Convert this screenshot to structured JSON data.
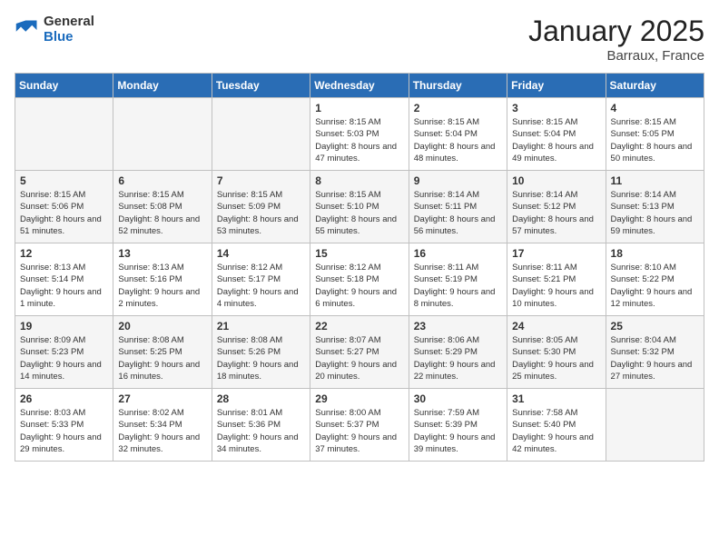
{
  "header": {
    "logo_general": "General",
    "logo_blue": "Blue",
    "title": "January 2025",
    "subtitle": "Barraux, France"
  },
  "weekdays": [
    "Sunday",
    "Monday",
    "Tuesday",
    "Wednesday",
    "Thursday",
    "Friday",
    "Saturday"
  ],
  "weeks": [
    [
      {
        "day": "",
        "info": ""
      },
      {
        "day": "",
        "info": ""
      },
      {
        "day": "",
        "info": ""
      },
      {
        "day": "1",
        "info": "Sunrise: 8:15 AM\nSunset: 5:03 PM\nDaylight: 8 hours\nand 47 minutes."
      },
      {
        "day": "2",
        "info": "Sunrise: 8:15 AM\nSunset: 5:04 PM\nDaylight: 8 hours\nand 48 minutes."
      },
      {
        "day": "3",
        "info": "Sunrise: 8:15 AM\nSunset: 5:04 PM\nDaylight: 8 hours\nand 49 minutes."
      },
      {
        "day": "4",
        "info": "Sunrise: 8:15 AM\nSunset: 5:05 PM\nDaylight: 8 hours\nand 50 minutes."
      }
    ],
    [
      {
        "day": "5",
        "info": "Sunrise: 8:15 AM\nSunset: 5:06 PM\nDaylight: 8 hours\nand 51 minutes."
      },
      {
        "day": "6",
        "info": "Sunrise: 8:15 AM\nSunset: 5:08 PM\nDaylight: 8 hours\nand 52 minutes."
      },
      {
        "day": "7",
        "info": "Sunrise: 8:15 AM\nSunset: 5:09 PM\nDaylight: 8 hours\nand 53 minutes."
      },
      {
        "day": "8",
        "info": "Sunrise: 8:15 AM\nSunset: 5:10 PM\nDaylight: 8 hours\nand 55 minutes."
      },
      {
        "day": "9",
        "info": "Sunrise: 8:14 AM\nSunset: 5:11 PM\nDaylight: 8 hours\nand 56 minutes."
      },
      {
        "day": "10",
        "info": "Sunrise: 8:14 AM\nSunset: 5:12 PM\nDaylight: 8 hours\nand 57 minutes."
      },
      {
        "day": "11",
        "info": "Sunrise: 8:14 AM\nSunset: 5:13 PM\nDaylight: 8 hours\nand 59 minutes."
      }
    ],
    [
      {
        "day": "12",
        "info": "Sunrise: 8:13 AM\nSunset: 5:14 PM\nDaylight: 9 hours\nand 1 minute."
      },
      {
        "day": "13",
        "info": "Sunrise: 8:13 AM\nSunset: 5:16 PM\nDaylight: 9 hours\nand 2 minutes."
      },
      {
        "day": "14",
        "info": "Sunrise: 8:12 AM\nSunset: 5:17 PM\nDaylight: 9 hours\nand 4 minutes."
      },
      {
        "day": "15",
        "info": "Sunrise: 8:12 AM\nSunset: 5:18 PM\nDaylight: 9 hours\nand 6 minutes."
      },
      {
        "day": "16",
        "info": "Sunrise: 8:11 AM\nSunset: 5:19 PM\nDaylight: 9 hours\nand 8 minutes."
      },
      {
        "day": "17",
        "info": "Sunrise: 8:11 AM\nSunset: 5:21 PM\nDaylight: 9 hours\nand 10 minutes."
      },
      {
        "day": "18",
        "info": "Sunrise: 8:10 AM\nSunset: 5:22 PM\nDaylight: 9 hours\nand 12 minutes."
      }
    ],
    [
      {
        "day": "19",
        "info": "Sunrise: 8:09 AM\nSunset: 5:23 PM\nDaylight: 9 hours\nand 14 minutes."
      },
      {
        "day": "20",
        "info": "Sunrise: 8:08 AM\nSunset: 5:25 PM\nDaylight: 9 hours\nand 16 minutes."
      },
      {
        "day": "21",
        "info": "Sunrise: 8:08 AM\nSunset: 5:26 PM\nDaylight: 9 hours\nand 18 minutes."
      },
      {
        "day": "22",
        "info": "Sunrise: 8:07 AM\nSunset: 5:27 PM\nDaylight: 9 hours\nand 20 minutes."
      },
      {
        "day": "23",
        "info": "Sunrise: 8:06 AM\nSunset: 5:29 PM\nDaylight: 9 hours\nand 22 minutes."
      },
      {
        "day": "24",
        "info": "Sunrise: 8:05 AM\nSunset: 5:30 PM\nDaylight: 9 hours\nand 25 minutes."
      },
      {
        "day": "25",
        "info": "Sunrise: 8:04 AM\nSunset: 5:32 PM\nDaylight: 9 hours\nand 27 minutes."
      }
    ],
    [
      {
        "day": "26",
        "info": "Sunrise: 8:03 AM\nSunset: 5:33 PM\nDaylight: 9 hours\nand 29 minutes."
      },
      {
        "day": "27",
        "info": "Sunrise: 8:02 AM\nSunset: 5:34 PM\nDaylight: 9 hours\nand 32 minutes."
      },
      {
        "day": "28",
        "info": "Sunrise: 8:01 AM\nSunset: 5:36 PM\nDaylight: 9 hours\nand 34 minutes."
      },
      {
        "day": "29",
        "info": "Sunrise: 8:00 AM\nSunset: 5:37 PM\nDaylight: 9 hours\nand 37 minutes."
      },
      {
        "day": "30",
        "info": "Sunrise: 7:59 AM\nSunset: 5:39 PM\nDaylight: 9 hours\nand 39 minutes."
      },
      {
        "day": "31",
        "info": "Sunrise: 7:58 AM\nSunset: 5:40 PM\nDaylight: 9 hours\nand 42 minutes."
      },
      {
        "day": "",
        "info": ""
      }
    ]
  ]
}
